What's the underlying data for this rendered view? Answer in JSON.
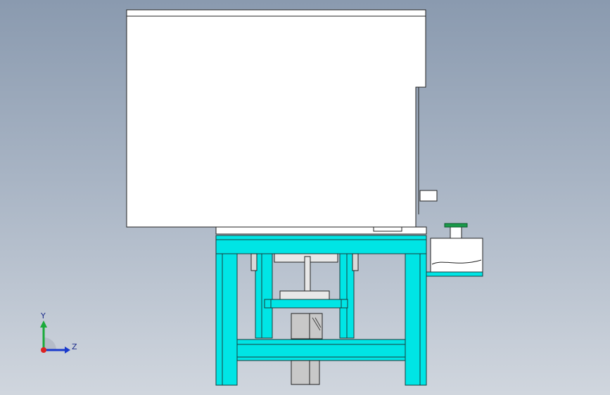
{
  "viewport": {
    "background_top": "#8a9aaf",
    "background_bottom": "#d0d6de"
  },
  "colors": {
    "frame_cyan": "#00e5e5",
    "frame_outline": "#1a3a3a",
    "panel_white": "#ffffff",
    "line_dark": "#222222",
    "motor_gray": "#c8c8c8",
    "accent_green": "#1a9a4a",
    "axis_y": "#1aaa3a",
    "axis_z": "#1a3acc",
    "axis_x": "#dd2222"
  },
  "triad": {
    "y_label": "Y",
    "z_label": "Z",
    "icon": "coordinate-triad-icon"
  }
}
